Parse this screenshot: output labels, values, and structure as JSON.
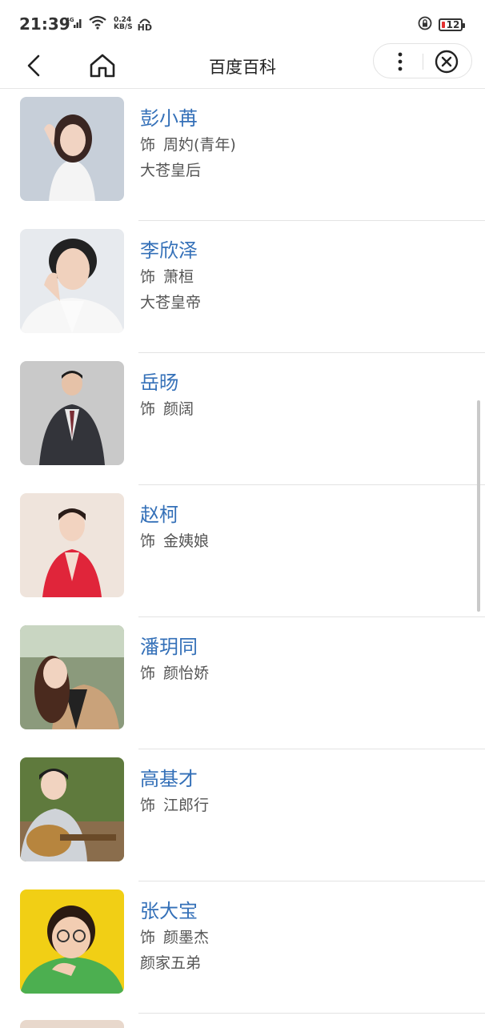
{
  "status_bar": {
    "time": "21:39",
    "network": "4G",
    "speed_value": "0.24",
    "speed_unit": "KB/S",
    "hd": "HD",
    "battery": "12"
  },
  "nav": {
    "title": "百度百科",
    "back_icon": "chevron-left-icon",
    "home_icon": "home-icon",
    "more_icon": "more-vertical-icon",
    "close_icon": "close-circle-icon"
  },
  "role_prefix": "饰",
  "cast": [
    {
      "name": "彭小苒",
      "role": "周妁(青年)",
      "extra": "大苍皇后"
    },
    {
      "name": "李欣泽",
      "role": "萧桓",
      "extra": "大苍皇帝"
    },
    {
      "name": "岳旸",
      "role": "颜阔",
      "extra": ""
    },
    {
      "name": "赵柯",
      "role": "金姨娘",
      "extra": ""
    },
    {
      "name": "潘玥同",
      "role": "颜怡娇",
      "extra": ""
    },
    {
      "name": "高基才",
      "role": "江郎行",
      "extra": ""
    },
    {
      "name": "张大宝",
      "role": "颜墨杰",
      "extra": "颜家五弟"
    }
  ],
  "colors": {
    "link_blue": "#3470b8",
    "battery_low": "#e23030"
  }
}
